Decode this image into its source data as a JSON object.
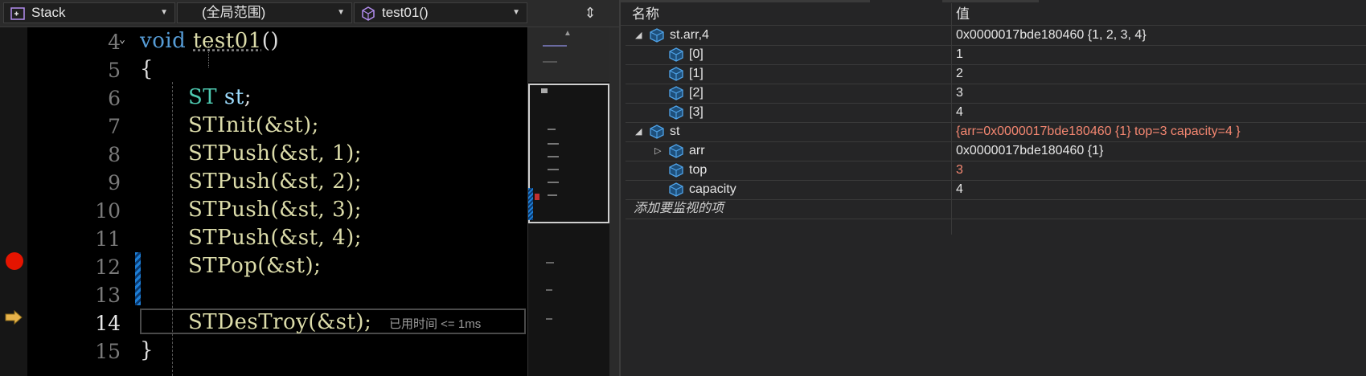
{
  "navbar": {
    "project": "Stack",
    "scope": "(全局范围)",
    "function": "test01()"
  },
  "code": {
    "lines": [
      {
        "num": "4",
        "text": "void test01()"
      },
      {
        "num": "5",
        "text": "{"
      },
      {
        "num": "6",
        "text": "ST st;"
      },
      {
        "num": "7",
        "text": "STInit(&st);"
      },
      {
        "num": "8",
        "text": "STPush(&st, 1);"
      },
      {
        "num": "9",
        "text": "STPush(&st, 2);"
      },
      {
        "num": "10",
        "text": "STPush(&st, 3);"
      },
      {
        "num": "11",
        "text": "STPush(&st, 4);"
      },
      {
        "num": "12",
        "text": "STPop(&st);"
      },
      {
        "num": "13",
        "text": ""
      },
      {
        "num": "14",
        "text": "STDesTroy(&st);"
      },
      {
        "num": "15",
        "text": "}"
      }
    ],
    "perf_tip": "已用时间 <= 1ms"
  },
  "watch": {
    "col_name": "名称",
    "col_value": "值",
    "rows": [
      {
        "name": "st.arr,4",
        "value": "0x0000017bde180460 {1, 2, 3, 4}",
        "expanded": true
      },
      {
        "name": "[0]",
        "value": "1"
      },
      {
        "name": "[1]",
        "value": "2"
      },
      {
        "name": "[2]",
        "value": "3"
      },
      {
        "name": "[3]",
        "value": "4"
      },
      {
        "name": "st",
        "value": "{arr=0x0000017bde180460 {1} top=3 capacity=4 }",
        "expanded": true
      },
      {
        "name": "arr",
        "value": "0x0000017bde180460 {1}"
      },
      {
        "name": "top",
        "value": "3"
      },
      {
        "name": "capacity",
        "value": "4"
      }
    ],
    "add_item_placeholder": "添加要监视的项"
  },
  "colors": {
    "keyword": "#569cd6",
    "type": "#4ec9b0",
    "function": "#dcdcaa",
    "changed_value": "#f48771",
    "breakpoint": "#e51400"
  }
}
